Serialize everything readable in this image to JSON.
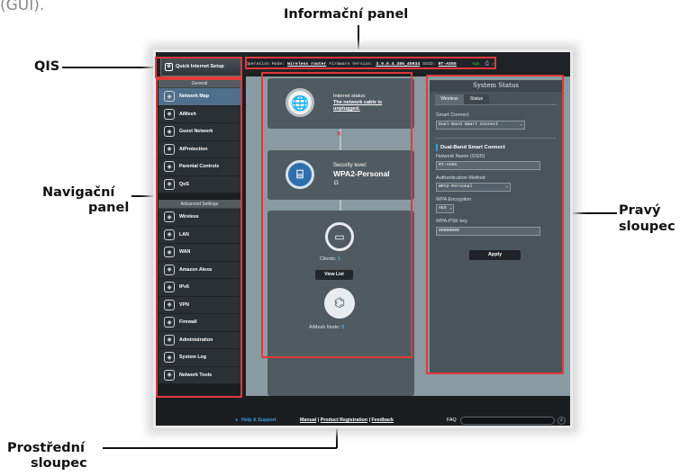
{
  "top_fragment": "(GUI).",
  "annotations": {
    "info_panel": "Informační panel",
    "qis": "QIS",
    "nav_line1": "Navigační",
    "nav_line2": "panel",
    "right_line1": "Pravý",
    "right_line2": "sloupec",
    "middle_line1": "Prostřední",
    "middle_line2": "sloupec"
  },
  "toolbar": {
    "qis_label": "Quick Internet Setup",
    "op_mode_label": "Operation Mode:",
    "op_mode_value": "Wireless router",
    "fw_label": "Firmware Version:",
    "fw_value": "3.0.0.4.386_45934",
    "ssid_label": "SSID:",
    "ssid_value": "RT-AX55",
    "app_label": "App"
  },
  "nav": {
    "general_header": "General",
    "general_items": [
      {
        "label": "Network Map",
        "icon": "network-map-icon"
      },
      {
        "label": "AiMesh",
        "icon": "aimesh-icon"
      },
      {
        "label": "Guest Network",
        "icon": "guest-network-icon"
      },
      {
        "label": "AiProtection",
        "icon": "aiprotection-icon"
      },
      {
        "label": "Parental Controls",
        "icon": "parental-controls-icon"
      },
      {
        "label": "QoS",
        "icon": "qos-icon"
      }
    ],
    "advanced_header": "Advanced Settings",
    "advanced_items": [
      {
        "label": "Wireless",
        "icon": "wireless-icon"
      },
      {
        "label": "LAN",
        "icon": "lan-icon"
      },
      {
        "label": "WAN",
        "icon": "wan-icon"
      },
      {
        "label": "Amazon Alexa",
        "icon": "alexa-icon"
      },
      {
        "label": "IPv6",
        "icon": "ipv6-icon"
      },
      {
        "label": "VPN",
        "icon": "vpn-icon"
      },
      {
        "label": "Firewall",
        "icon": "firewall-icon"
      },
      {
        "label": "Administration",
        "icon": "administration-icon"
      },
      {
        "label": "System Log",
        "icon": "system-log-icon"
      },
      {
        "label": "Network Tools",
        "icon": "network-tools-icon"
      }
    ]
  },
  "middle": {
    "internet_status_label": "Internet status:",
    "internet_status_value": "The network cable is unplugged.",
    "security_label": "Security level:",
    "security_value": "WPA2-Personal",
    "clients_label": "Clients:",
    "clients_count": "1",
    "view_list": "View List",
    "aimesh_label": "AiMesh Node:",
    "aimesh_count": "0"
  },
  "right": {
    "title": "System Status",
    "tabs": [
      "Wireless",
      "Status"
    ],
    "smart_connect_label": "Smart Connect",
    "smart_connect_value": "Dual-Band Smart Connect",
    "section_title": "Dual-Band Smart Connect",
    "ssid_label": "Network Name (SSID)",
    "ssid_value": "RT-AX55",
    "auth_label": "Authentication Method",
    "auth_value": "WPA2-Personal",
    "enc_label": "WPA Encryption",
    "enc_value": "AES",
    "psk_label": "WPA-PSK key",
    "psk_value": "00000000",
    "apply": "Apply"
  },
  "footer": {
    "help": "Help & Support",
    "manual": "Manual",
    "sep1": "|",
    "product_reg": "Product Registration",
    "sep2": "|",
    "feedback": "Feedback",
    "faq": "FAQ"
  }
}
